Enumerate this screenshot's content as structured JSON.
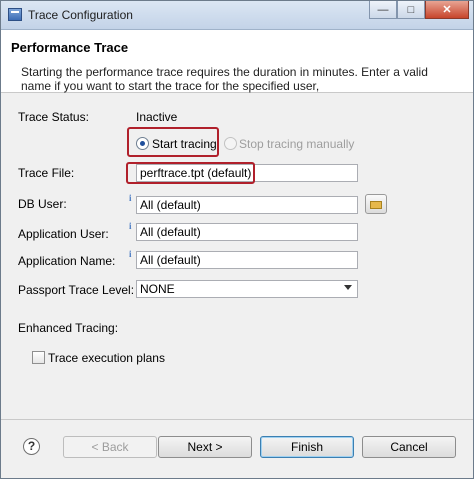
{
  "window": {
    "title": "Trace Configuration"
  },
  "header": {
    "title": "Performance Trace",
    "description": "Starting the performance trace requires the duration in minutes. Enter a valid name if you want to start the trace for the specified user,"
  },
  "form": {
    "trace_status": {
      "label": "Trace Status:",
      "value": "Inactive"
    },
    "radio_start": {
      "label": "Start tracing",
      "checked": true
    },
    "radio_stop": {
      "label": "Stop tracing manually",
      "enabled": false
    },
    "trace_file": {
      "label": "Trace File:",
      "value": "perftrace.tpt (default)"
    },
    "db_user": {
      "label": "DB User:",
      "value": "All (default)"
    },
    "application_user": {
      "label": "Application User:",
      "value": "All (default)"
    },
    "application_name": {
      "label": "Application Name:",
      "value": "All (default)"
    },
    "passport_trace_level": {
      "label": "Passport Trace Level:",
      "value": "NONE"
    },
    "enhanced_tracing": {
      "label": "Enhanced Tracing:"
    },
    "trace_execution_plans": {
      "label": "Trace execution plans",
      "checked": false
    }
  },
  "footer": {
    "help": "?",
    "back": "< Back",
    "next": "Next >",
    "finish": "Finish",
    "cancel": "Cancel"
  },
  "colors": {
    "highlight": "#b0202b",
    "default_button": "#3c7fb1"
  }
}
